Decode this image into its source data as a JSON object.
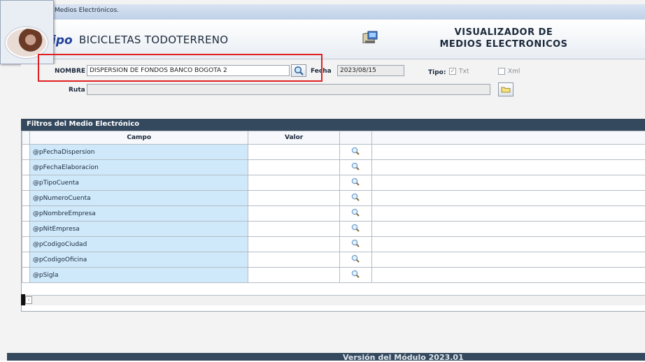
{
  "window": {
    "title": "Medios Electrónicos."
  },
  "header": {
    "brand": "ipo",
    "company": "BICICLETAS TODOTERRENO",
    "module_title_line1": "VISUALIZADOR DE",
    "module_title_line2": "MEDIOS ELECTRONICOS"
  },
  "form": {
    "nombre_label": "NOMBRE",
    "nombre_value": "DISPERSION DE FONDOS BANCO BOGOTA 2",
    "fecha_label": "Fecha",
    "fecha_value": "2023/08/15",
    "tipo_label": "Tipo:",
    "txt_label": "Txt",
    "txt_checked": true,
    "xml_label": "Xml",
    "xml_checked": false,
    "ruta_label": "Ruta",
    "ruta_value": ""
  },
  "filters": {
    "title": "Filtros del  Medio Electrónico",
    "columns": [
      "Campo",
      "Valor"
    ],
    "rows": [
      {
        "campo": "@pFechaDispersion",
        "valor": ""
      },
      {
        "campo": "@pFechaElaboracion",
        "valor": ""
      },
      {
        "campo": "@pTipoCuenta",
        "valor": ""
      },
      {
        "campo": "@pNumeroCuenta",
        "valor": ""
      },
      {
        "campo": "@pNombreEmpresa",
        "valor": ""
      },
      {
        "campo": "@pNitEmpresa",
        "valor": ""
      },
      {
        "campo": "@pCodigoCiudad",
        "valor": ""
      },
      {
        "campo": "@pCodigoOficina",
        "valor": ""
      },
      {
        "campo": "@pSigla",
        "valor": ""
      }
    ]
  },
  "footer": {
    "version": "Versión del Módulo 2023.01"
  },
  "colors": {
    "panel_header": "#34495e",
    "campo_bg": "#cfe9fb",
    "highlight": "#e02020",
    "brand": "#1f3f98"
  }
}
